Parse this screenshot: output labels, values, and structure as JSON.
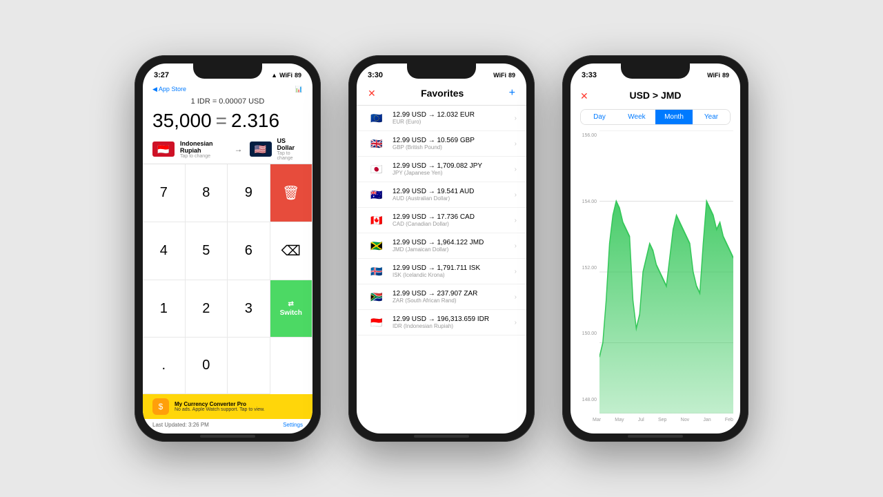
{
  "background": "#e8e8e8",
  "phone1": {
    "status_time": "3:27",
    "status_icons": "▲ ◀ ▶ 89",
    "nav_back": "◀ App Store",
    "title": "1 IDR = 0.00007 USD",
    "input_value": "35,000",
    "equals": "=",
    "output_value": "2.316",
    "from_currency": "Indonesian Rupiah",
    "from_tap": "Tap to change",
    "to_currency": "US Dollar",
    "to_tap": "Tap to change",
    "keys": [
      "7",
      "8",
      "9",
      "⌫",
      "4",
      "5",
      "6",
      "⌦",
      "1",
      "2",
      "3",
      "⇄",
      ".",
      "0",
      ""
    ],
    "delete_label": "🗑",
    "switch_label": "Switch",
    "banner_title": "My Currency Converter Pro",
    "banner_sub": "No ads. Apple Watch support. Tap to view.",
    "last_updated": "Last Updated: 3:26 PM",
    "settings": "Settings"
  },
  "phone2": {
    "status_time": "3:30",
    "title": "Favorites",
    "items": [
      {
        "flag": "🇪🇺",
        "conversion": "12.99 USD → 12.032 EUR",
        "label": "EUR (Euro)"
      },
      {
        "flag": "🇬🇧",
        "conversion": "12.99 USD → 10.569 GBP",
        "label": "GBP (British Pound)"
      },
      {
        "flag": "🇯🇵",
        "conversion": "12.99 USD → 1,709.082 JPY",
        "label": "JPY (Japanese Yen)"
      },
      {
        "flag": "🇦🇺",
        "conversion": "12.99 USD → 19.541 AUD",
        "label": "AUD (Australian Dollar)"
      },
      {
        "flag": "🇨🇦",
        "conversion": "12.99 USD → 17.736 CAD",
        "label": "CAD (Canadian Dollar)"
      },
      {
        "flag": "🇯🇲",
        "conversion": "12.99 USD → 1,964.122 JMD",
        "label": "JMD (Jamaican Dollar)"
      },
      {
        "flag": "🇮🇸",
        "conversion": "12.99 USD → 1,791.711 ISK",
        "label": "ISK (Icelandic Krona)"
      },
      {
        "flag": "🇿🇦",
        "conversion": "12.99 USD → 237.907 ZAR",
        "label": "ZAR (South African Rand)"
      },
      {
        "flag": "🇮🇩",
        "conversion": "12.99 USD → 196,313.659 IDR",
        "label": "IDR (Indonesian Rupiah)"
      }
    ]
  },
  "phone3": {
    "status_time": "3:33",
    "title": "USD > JMD",
    "tabs": [
      "Day",
      "Week",
      "Month",
      "Year"
    ],
    "active_tab": "Month",
    "y_labels": [
      "156.00",
      "154.00",
      "152.00",
      "150.00",
      "148.00"
    ],
    "x_labels": [
      "Mar",
      "May",
      "Jul",
      "Sep",
      "Nov",
      "Jan",
      "Feb"
    ],
    "chart_color": "#34c759"
  }
}
